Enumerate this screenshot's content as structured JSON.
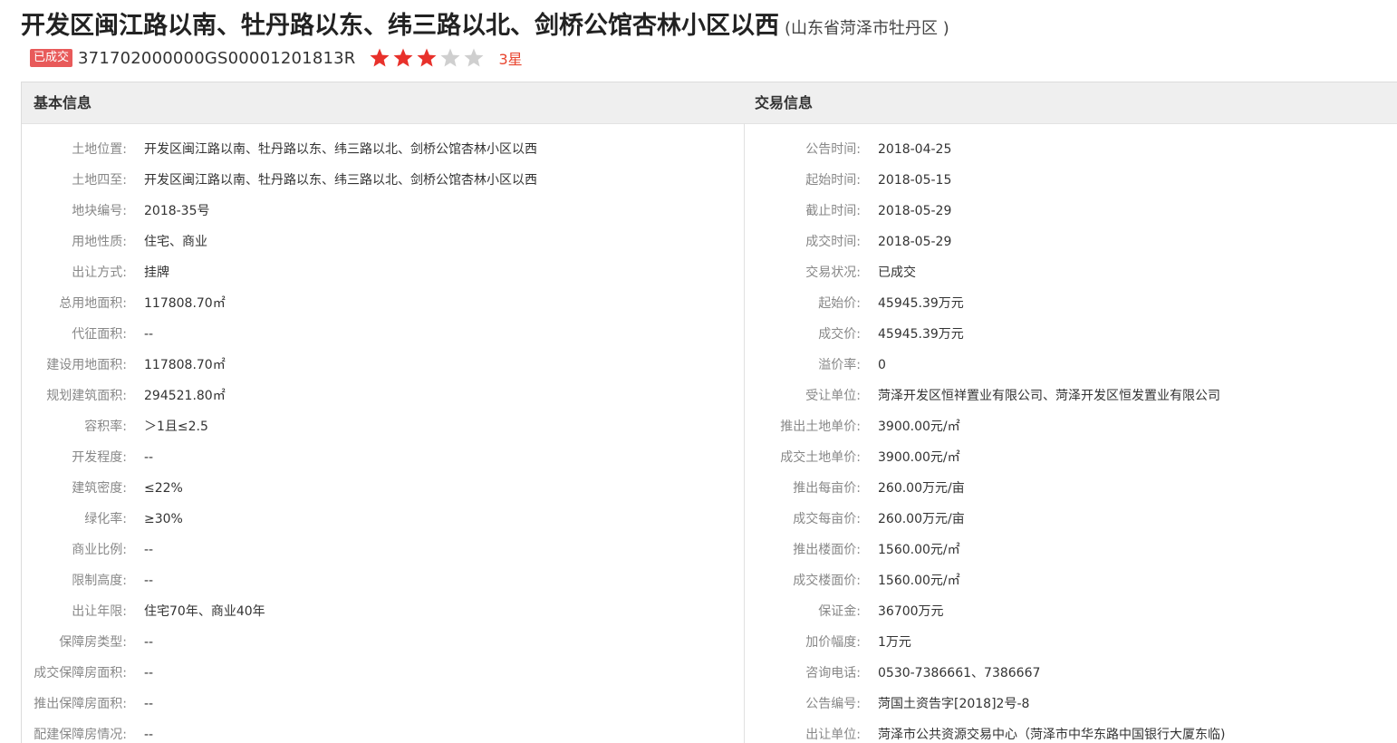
{
  "header": {
    "title": "开发区闽江路以南、牡丹路以东、纬三路以北、剑桥公馆杏林小区以西",
    "region": "(山东省菏泽市牡丹区 )",
    "status_badge": "已成交",
    "code": "371702000000GS00001201813R",
    "rating": 3,
    "rating_max": 5,
    "rating_text": "3星",
    "star_color_on": "#e8312b",
    "star_color_off": "#cfcfcf"
  },
  "basic": {
    "heading": "基本信息",
    "rows": [
      {
        "label": "土地位置:",
        "value": "开发区闽江路以南、牡丹路以东、纬三路以北、剑桥公馆杏林小区以西"
      },
      {
        "label": "土地四至:",
        "value": "开发区闽江路以南、牡丹路以东、纬三路以北、剑桥公馆杏林小区以西"
      },
      {
        "label": "地块编号:",
        "value": "2018-35号"
      },
      {
        "label": "用地性质:",
        "value": "住宅、商业"
      },
      {
        "label": "出让方式:",
        "value": "挂牌"
      },
      {
        "label": "总用地面积:",
        "value": "117808.70㎡"
      },
      {
        "label": "代征面积:",
        "value": "--"
      },
      {
        "label": "建设用地面积:",
        "value": "117808.70㎡"
      },
      {
        "label": "规划建筑面积:",
        "value": "294521.80㎡"
      },
      {
        "label": "容积率:",
        "value": "＞1且≤2.5"
      },
      {
        "label": "开发程度:",
        "value": "--"
      },
      {
        "label": "建筑密度:",
        "value": "≤22%"
      },
      {
        "label": "绿化率:",
        "value": "≥30%"
      },
      {
        "label": "商业比例:",
        "value": "--"
      },
      {
        "label": "限制高度:",
        "value": "--"
      },
      {
        "label": "出让年限:",
        "value": "住宅70年、商业40年"
      },
      {
        "label": "保障房类型:",
        "value": "--"
      },
      {
        "label": "成交保障房面积:",
        "value": "--"
      },
      {
        "label": "推出保障房面积:",
        "value": "--"
      },
      {
        "label": "配建保障房情况:",
        "value": "--"
      }
    ]
  },
  "trade": {
    "heading": "交易信息",
    "rows": [
      {
        "label": "公告时间:",
        "value": "2018-04-25"
      },
      {
        "label": "起始时间:",
        "value": "2018-05-15"
      },
      {
        "label": "截止时间:",
        "value": "2018-05-29"
      },
      {
        "label": "成交时间:",
        "value": "2018-05-29"
      },
      {
        "label": "交易状况:",
        "value": "已成交"
      },
      {
        "label": "起始价:",
        "value": "45945.39万元"
      },
      {
        "label": "成交价:",
        "value": "45945.39万元"
      },
      {
        "label": "溢价率:",
        "value": "0"
      },
      {
        "label": "受让单位:",
        "value": "菏泽开发区恒祥置业有限公司、菏泽开发区恒发置业有限公司"
      },
      {
        "label": "推出土地单价:",
        "value": "3900.00元/㎡"
      },
      {
        "label": "成交土地单价:",
        "value": "3900.00元/㎡"
      },
      {
        "label": "推出每亩价:",
        "value": "260.00万元/亩"
      },
      {
        "label": "成交每亩价:",
        "value": "260.00万元/亩"
      },
      {
        "label": "推出楼面价:",
        "value": "1560.00元/㎡"
      },
      {
        "label": "成交楼面价:",
        "value": "1560.00元/㎡"
      },
      {
        "label": "保证金:",
        "value": "36700万元"
      },
      {
        "label": "加价幅度:",
        "value": "1万元"
      },
      {
        "label": "咨询电话:",
        "value": "0530-7386661、7386667"
      },
      {
        "label": "公告编号:",
        "value": "菏国土资告字[2018]2号-8"
      },
      {
        "label": "出让单位:",
        "value": "菏泽市公共资源交易中心（菏泽市中华东路中国银行大厦东临)"
      }
    ]
  }
}
